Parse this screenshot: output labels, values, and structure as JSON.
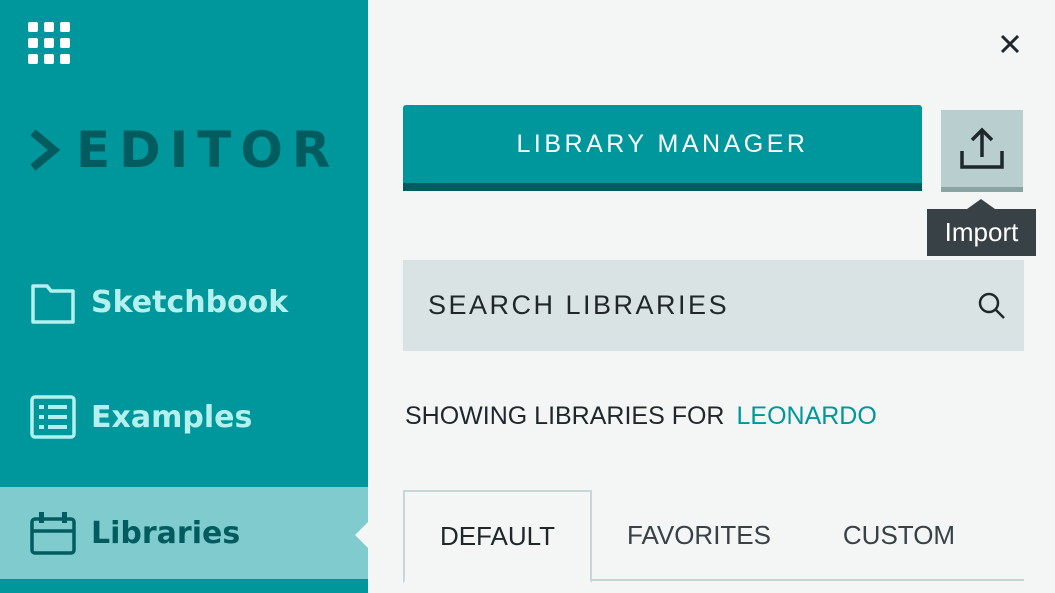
{
  "sidebar": {
    "logo_text": "EDITOR",
    "items": [
      {
        "label": "Sketchbook",
        "icon": "folder-icon"
      },
      {
        "label": "Examples",
        "icon": "list-icon"
      },
      {
        "label": "Libraries",
        "icon": "library-icon",
        "active": true
      }
    ]
  },
  "panel": {
    "library_manager_label": "LIBRARY MANAGER",
    "import_tooltip": "Import",
    "search_placeholder": "SEARCH LIBRARIES",
    "showing_label": "SHOWING LIBRARIES FOR",
    "board_name": "LEONARDO",
    "tabs": [
      {
        "label": "DEFAULT",
        "active": true
      },
      {
        "label": "FAVORITES"
      },
      {
        "label": "CUSTOM"
      }
    ]
  },
  "colors": {
    "sidebar_bg": "#00979c",
    "sidebar_active": "#7fcbcd",
    "accent_dark": "#005c5f",
    "nav_text": "#b4f1ee",
    "panel_bg": "#f4f6f6",
    "search_bg": "#dae3e3",
    "tooltip_bg": "#374146"
  }
}
